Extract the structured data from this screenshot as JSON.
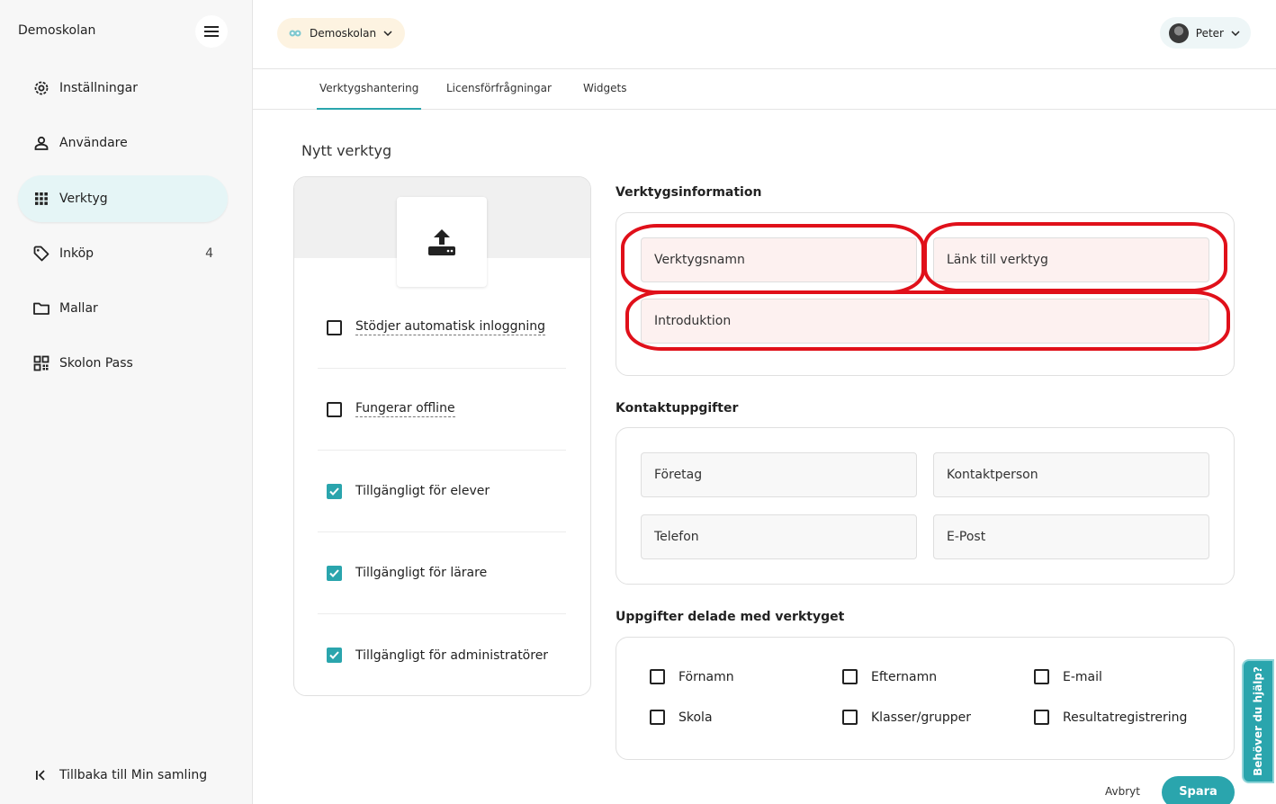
{
  "sidebar": {
    "brand": "Demoskolan",
    "items": [
      {
        "label": "Inställningar",
        "icon": "gear-icon"
      },
      {
        "label": "Användare",
        "icon": "person-icon"
      },
      {
        "label": "Verktyg",
        "icon": "grid-icon",
        "active": true
      },
      {
        "label": "Inköp",
        "icon": "tag-icon",
        "count": "4"
      },
      {
        "label": "Mallar",
        "icon": "folder-icon"
      },
      {
        "label": "Skolon Pass",
        "icon": "qr-icon"
      }
    ],
    "back_label": "Tillbaka till Min samling"
  },
  "topbar": {
    "school": "Demoskolan",
    "user": "Peter"
  },
  "tabs": [
    {
      "label": "Verktygshantering",
      "active": true
    },
    {
      "label": "Licensförfrågningar"
    },
    {
      "label": "Widgets"
    }
  ],
  "page": {
    "title": "Nytt verktyg"
  },
  "options": [
    {
      "label": "Stödjer automatisk inloggning",
      "checked": false,
      "dotted": true
    },
    {
      "label": "Fungerar offline",
      "checked": false,
      "dotted": true
    },
    {
      "label": "Tillgängligt för elever",
      "checked": true
    },
    {
      "label": "Tillgängligt för lärare",
      "checked": true
    },
    {
      "label": "Tillgängligt för administratörer",
      "checked": true
    }
  ],
  "tool_info": {
    "title": "Verktygsinformation",
    "name_placeholder": "Verktygsnamn",
    "link_placeholder": "Länk till verktyg",
    "intro_placeholder": "Introduktion"
  },
  "contact": {
    "title": "Kontaktuppgifter",
    "company_placeholder": "Företag",
    "person_placeholder": "Kontaktperson",
    "phone_placeholder": "Telefon",
    "email_placeholder": "E-Post"
  },
  "shared": {
    "title": "Uppgifter delade med verktyget",
    "items": [
      "Förnamn",
      "Efternamn",
      "E-mail",
      "Skola",
      "Klasser/grupper",
      "Resultatregistrering"
    ]
  },
  "actions": {
    "cancel": "Avbryt",
    "save": "Spara"
  },
  "help": {
    "label": "Behöver du hjälp?"
  },
  "colors": {
    "accent": "#2aa5ad",
    "highlight": "#e0101a"
  }
}
